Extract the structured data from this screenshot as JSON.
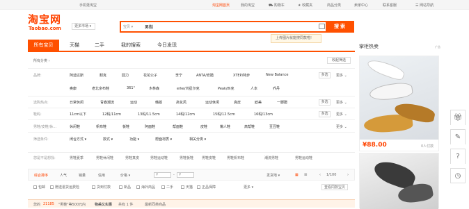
{
  "topbar": {
    "mobile": "手机逛淘宝",
    "login": "淘宝网首页",
    "my": "我的淘宝",
    "cart": "购物车",
    "fav": "收藏夹",
    "cats": "商品分类",
    "seller": "卖家中心",
    "service": "联系客服",
    "sitemap": "网站导航"
  },
  "logo": {
    "cn": "淘宝网",
    "en": "Taobao.com"
  },
  "mobile_market": "更多市场",
  "search": {
    "category": "宝贝",
    "value": "男鞋",
    "button": "搜索",
    "tip": "上传图片就能搜同款啦!"
  },
  "tabs": [
    "所有宝贝",
    "天猫",
    "二手",
    "我的搜索",
    "今日发现"
  ],
  "side": {
    "title": "掌柜热卖",
    "ad": "广告"
  },
  "breadcrumb": "所有分类",
  "collapse": "收起筛选",
  "filters": [
    {
      "label": "品牌:",
      "items": [
        "阿迪达斯",
        "耐克",
        "回力",
        "花花公子",
        "李宁",
        "ANTA/安踏",
        "XTEP/特步",
        "New Balance",
        "奥康",
        "老北京布鞋",
        "361°",
        "木林森",
        "erke/鸿星尔克",
        "Peak/匹克",
        "人本",
        "乔丹"
      ],
      "multi": "多选",
      "more": "更多"
    },
    {
      "label": "选购热点:",
      "items": [
        "日常休闲",
        "青春潮流",
        "运动",
        "韩版",
        "高化风",
        "运动休闲",
        "真皮",
        "欧美",
        "一脚蹬"
      ],
      "multi": "多选",
      "more": "更多"
    },
    {
      "label": "鞋码:",
      "items": [
        "11cm以下",
        "12码/11cm",
        "13码/11.5cm",
        "14码/12cm",
        "15码/12.5cm",
        "16码/13cm"
      ],
      "multi": "多选",
      "more": "更多"
    },
    {
      "label": "男鞋/皮鞋/休...",
      "items": [
        "休闲鞋",
        "帆布鞋",
        "板鞋",
        "阿面鞋",
        "帮面鞋",
        "皮鞋",
        "懒人鞋",
        "高帮鞋",
        "豆豆鞋"
      ],
      "more": "更多"
    },
    {
      "label": "筛选条件:",
      "items": [
        "闭合方式",
        "款式",
        "功能",
        "帮面材质",
        "相关分类"
      ]
    }
  ],
  "related": {
    "label": "您是不是想找:",
    "items": [
      "男鞋夏季",
      "男鞋休闲鞋",
      "男鞋真皮",
      "男鞋运动鞋",
      "男鞋板鞋",
      "男鞋皮鞋",
      "男鞋帆布鞋",
      "潮流男鞋",
      "男鞋运动鞋"
    ]
  },
  "sort": {
    "items": [
      "综合排序",
      "人气",
      "销量",
      "信用",
      "价格"
    ],
    "price_from": "¥",
    "price_to": "¥",
    "ship": "发货地",
    "page": "1/100"
  },
  "checks": [
    "包邮",
    "赠送退货运费险",
    "货到付款",
    "新品",
    "海外商品",
    "二手",
    "天猫",
    "正品保障"
  ],
  "check_more": "更多",
  "check_btn": "查看同款宝贝",
  "bottom": {
    "a": "您的",
    "b": "21185",
    "c": "\"男鞋\"等500元内",
    "d": "物美又实惠",
    "e": "共有 1 件",
    "f": "最新同类商品"
  },
  "products": [
    {
      "price": "¥88.00",
      "buyers": "0人付款"
    }
  ]
}
